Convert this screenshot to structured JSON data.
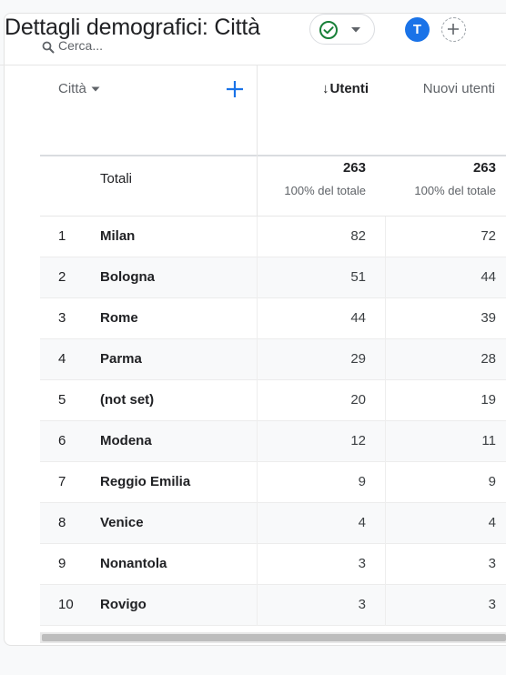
{
  "header": {
    "title": "Dettagli demografici: Città",
    "avatar_letter": "T"
  },
  "search": {
    "placeholder": "Cerca..."
  },
  "table": {
    "dimension_label": "Città",
    "columns": {
      "users": "Utenti",
      "new_users": "Nuovi utenti"
    },
    "totals": {
      "label": "Totali",
      "users": "263",
      "users_sub": "100% del totale",
      "new_users": "263",
      "new_users_sub": "100% del totale"
    },
    "rows": [
      {
        "rank": "1",
        "city": "Milan",
        "users": "82",
        "new_users": "72"
      },
      {
        "rank": "2",
        "city": "Bologna",
        "users": "51",
        "new_users": "44"
      },
      {
        "rank": "3",
        "city": "Rome",
        "users": "44",
        "new_users": "39"
      },
      {
        "rank": "4",
        "city": "Parma",
        "users": "29",
        "new_users": "28"
      },
      {
        "rank": "5",
        "city": "(not set)",
        "users": "20",
        "new_users": "19"
      },
      {
        "rank": "6",
        "city": "Modena",
        "users": "12",
        "new_users": "11"
      },
      {
        "rank": "7",
        "city": "Reggio Emilia",
        "users": "9",
        "new_users": "9"
      },
      {
        "rank": "8",
        "city": "Venice",
        "users": "4",
        "new_users": "4"
      },
      {
        "rank": "9",
        "city": "Nonantola",
        "users": "3",
        "new_users": "3"
      },
      {
        "rank": "10",
        "city": "Rovigo",
        "users": "3",
        "new_users": "3"
      }
    ]
  },
  "icons": {
    "status": "check-circle-icon",
    "status_menu": "chevron-down-icon",
    "search": "search-icon",
    "add_dimension": "plus-icon",
    "add_comparison": "plus-icon",
    "sort": "arrow-down-icon",
    "dimension_menu": "caret-down-icon"
  },
  "colors": {
    "accent": "#1a73e8",
    "status_ok": "#188038",
    "text": "#202124",
    "muted": "#5f6368"
  }
}
